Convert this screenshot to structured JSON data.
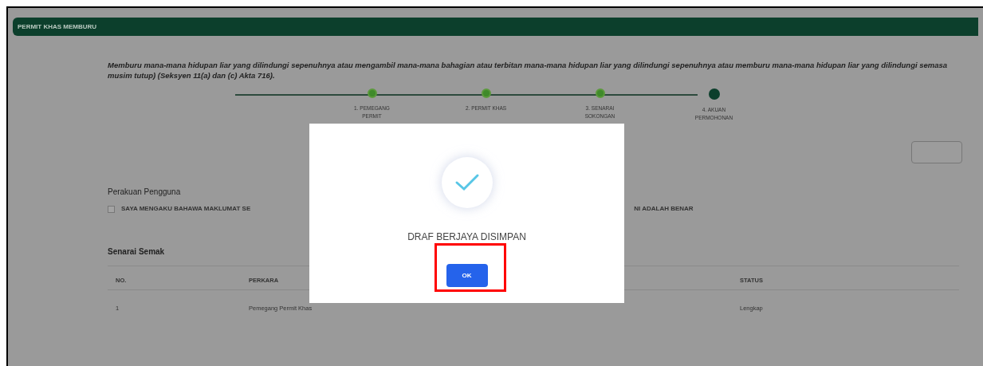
{
  "header": {
    "title": "PERMIT KHAS MEMBURU"
  },
  "description": "Memburu mana-mana hidupan liar yang dilindungi sepenuhnya atau mengambil mana-mana bahagian atau terbitan mana-mana hidupan liar yang dilindungi sepenuhnya atau memburu mana-mana hidupan liar yang dilindungi semasa musim tutup) (Seksyen 11(a) dan (c) Akta 716).",
  "steps": [
    {
      "label": "1. PEMEGANG PERMIT",
      "completed": true
    },
    {
      "label": "2. PERMIT KHAS",
      "completed": true
    },
    {
      "label": "3. SENARAI SOKONGAN",
      "completed": true
    },
    {
      "label": "4. AKUAN PERMOHONAN",
      "completed": false
    }
  ],
  "declaration": {
    "title": "Perakuan Pengguna",
    "checked": false,
    "text_start": "SAYA MENGAKU BAHAWA MAKLUMAT SE",
    "text_end": "NI ADALAH BENAR"
  },
  "checklist": {
    "title": "Senarai Semak",
    "columns": [
      "NO.",
      "PERKARA",
      "STATUS"
    ],
    "rows": [
      {
        "no": "1",
        "item": "Pemegang Permit Khas",
        "status": "Lengkap"
      }
    ]
  },
  "modal": {
    "message": "DRAF BERJAYA DISIMPAN",
    "button": "OK",
    "highlighted": true
  }
}
